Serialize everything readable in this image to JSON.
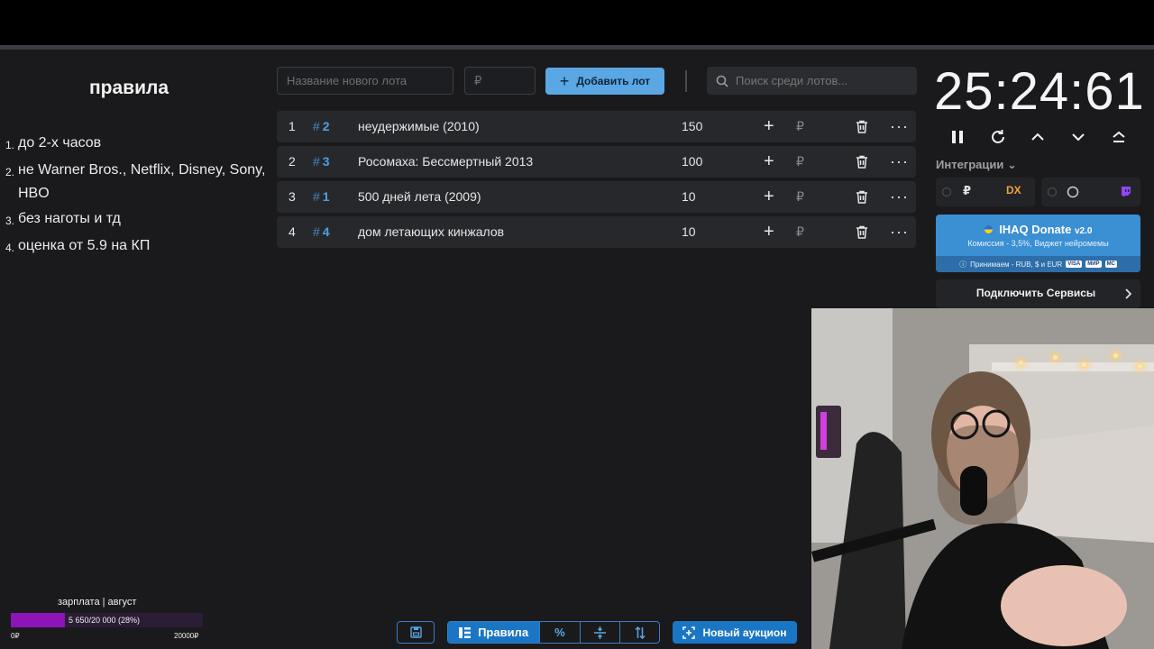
{
  "rules": {
    "title": "правила",
    "items": [
      {
        "num": "1.",
        "text": "до 2-х часов"
      },
      {
        "num": "2.",
        "text": "не Warner Bros., Netflix, Disney, Sony, HBO"
      },
      {
        "num": "3.",
        "text": "без наготы и тд"
      },
      {
        "num": "4.",
        "text": "оценка от 5.9 на КП"
      }
    ]
  },
  "toolbar": {
    "lot_name_placeholder": "Название нового лота",
    "lot_price_placeholder": "₽",
    "add_lot_label": "Добавить лот",
    "search_placeholder": "Поиск среди лотов..."
  },
  "lots": [
    {
      "index": "1",
      "id": "2",
      "name": "неудержимые (2010)",
      "amount": "150",
      "currency": "₽"
    },
    {
      "index": "2",
      "id": "3",
      "name": "Росомаха: Бессмертный 2013",
      "amount": "100",
      "currency": "₽"
    },
    {
      "index": "3",
      "id": "1",
      "name": "500 дней лета (2009)",
      "amount": "10",
      "currency": "₽"
    },
    {
      "index": "4",
      "id": "4",
      "name": "дом летающих кинжалов",
      "amount": "10",
      "currency": "₽"
    }
  ],
  "timer": {
    "value": "25:24:61"
  },
  "integrations": {
    "label": "Интеграции",
    "donatepay_symbol": "₽",
    "dx_label": "DX"
  },
  "donate_banner": {
    "title": "IHAQ Donate",
    "version": "v2.0",
    "subtitle": "Комиссия - 3,5%, Виджет нейромемы",
    "accepts": "Принимаем - RUB, $ и EUR",
    "cards": [
      "VISA",
      "МИР",
      "MC"
    ]
  },
  "connect_services": {
    "label": "Подключить Сервисы"
  },
  "goal": {
    "title": "зарплата | август",
    "text": "5 650/20 000 (28%)",
    "min": "0₽",
    "max": "20000₽",
    "progress": 0.28
  },
  "bottom": {
    "rules_label": "Правила",
    "percent_label": "%",
    "new_auction_label": "Новый аукцион"
  },
  "colors": {
    "accent": "#5aa7e4",
    "primary": "#1a76c4",
    "goal_fill": "#8d14b8",
    "background": "#1a1a1c"
  }
}
